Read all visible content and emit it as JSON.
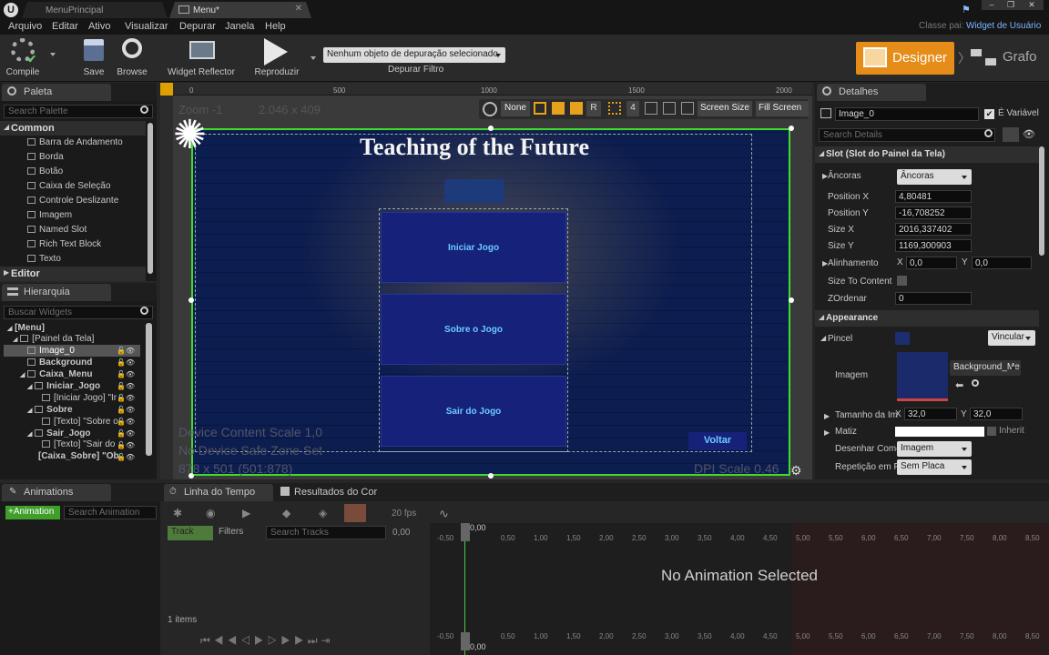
{
  "titlebar": {
    "tabs": [
      "MenuPrincipal",
      "Menu*"
    ],
    "parent_class_label": "Classe pai:",
    "parent_class_value": "Widget de Usuário"
  },
  "menu": [
    "Arquivo",
    "Editar",
    "Ativo",
    "Visualizar",
    "Depurar",
    "Janela",
    "Help"
  ],
  "toolbar": {
    "compile": "Compile",
    "save": "Save",
    "browse": "Browse",
    "widget_reflector": "Widget Reflector",
    "play": "Reproduzir",
    "debug_select": "Nenhum objeto de depuração selecionado",
    "debug_filter": "Depurar Filtro",
    "designer": "Designer",
    "graph": "Grafo"
  },
  "palette": {
    "title": "Paleta",
    "search_placeholder": "Search Palette",
    "category": "Common",
    "items": [
      "Barra de Andamento",
      "Borda",
      "Botão",
      "Caixa de Seleção",
      "Controle Deslizante",
      "Imagem",
      "Named Slot",
      "Rich Text Block",
      "Texto"
    ],
    "editor_category": "Editor"
  },
  "hierarchy": {
    "title": "Hierarquia",
    "search_placeholder": "Buscar Widgets",
    "items": [
      "[Menu]",
      "[Painel da Tela]",
      "Image_0",
      "Background",
      "Caixa_Menu",
      "Iniciar_Jogo",
      "[Iniciar Jogo] \"Ir",
      "Sobre",
      "[Texto] \"Sobre o",
      "Sair_Jogo",
      "[Texto] \"Sair do",
      "[Caixa_Sobre] \"Ob"
    ]
  },
  "canvas": {
    "zoom": "Zoom -1",
    "resolution": "2.046 x 409",
    "title": "Teaching of the Future",
    "btn1": "Iniciar Jogo",
    "btn2": "Sobre o Jogo",
    "btn3": "Sair do Jogo",
    "back": "Voltar",
    "device_scale": "Device Content Scale 1,0",
    "safe_zone": "No Device Safe Zone Set",
    "size_info": "878 x 501 (501:878)",
    "dpi": "DPI Scale 0,46",
    "ruler": [
      "0",
      "500",
      "1000",
      "1500",
      "2000"
    ],
    "tool_none": "None",
    "tool_r": "R",
    "tool_4": "4",
    "screen_size": "Screen Size",
    "fill_screen": "Fill Screen"
  },
  "details": {
    "title": "Detalhes",
    "name": "Image_0",
    "variable": "É Variável",
    "search_placeholder": "Search Details",
    "slot_section": "Slot (Slot do Painel da Tela)",
    "anchors_label": "Âncoras",
    "anchors_value": "Âncoras",
    "pos_x_label": "Position X",
    "pos_x": "4,80481",
    "pos_y_label": "Position Y",
    "pos_y": "-16,708252",
    "size_x_label": "Size X",
    "size_x": "2016,337402",
    "size_y_label": "Size Y",
    "size_y": "1169,300903",
    "align_label": "Alinhamento",
    "align_x": "0,0",
    "align_y": "0,0",
    "size_to_content": "Size To Content",
    "zorder_label": "ZOrdenar",
    "zorder": "0",
    "appearance": "Appearance",
    "brush_label": "Pincel",
    "bind": "Vincular",
    "image_label": "Imagem",
    "image_value": "Background_Me",
    "image_size_label": "Tamanho da Im",
    "image_size_x": "32,0",
    "image_size_y": "32,0",
    "tint_label": "Matiz",
    "inherit": "Inherit",
    "draw_as_label": "Desenhar Como",
    "draw_as": "Imagem",
    "tiling_label": "Repetição em P",
    "tiling": "Sem Placa"
  },
  "animations": {
    "title": "Animations",
    "add": "+Animation",
    "search_placeholder": "Search Animation"
  },
  "timeline": {
    "tab1": "Linha do Tempo",
    "tab2": "Resultados do Cor",
    "fps": "20 fps",
    "track": "Track",
    "filters": "Filters",
    "search_tracks": "Search Tracks",
    "time": "0,00",
    "no_anim": "No Animation Selected",
    "items": "1 items",
    "ticks": [
      "-0,50",
      "0,00",
      "0,50",
      "1,00",
      "1,50",
      "2,00",
      "2,50",
      "3,00",
      "3,50",
      "4,00",
      "4,50",
      "5,00",
      "5,50",
      "6,00",
      "6,50",
      "7,00",
      "7,50",
      "8,00",
      "8,50"
    ]
  }
}
